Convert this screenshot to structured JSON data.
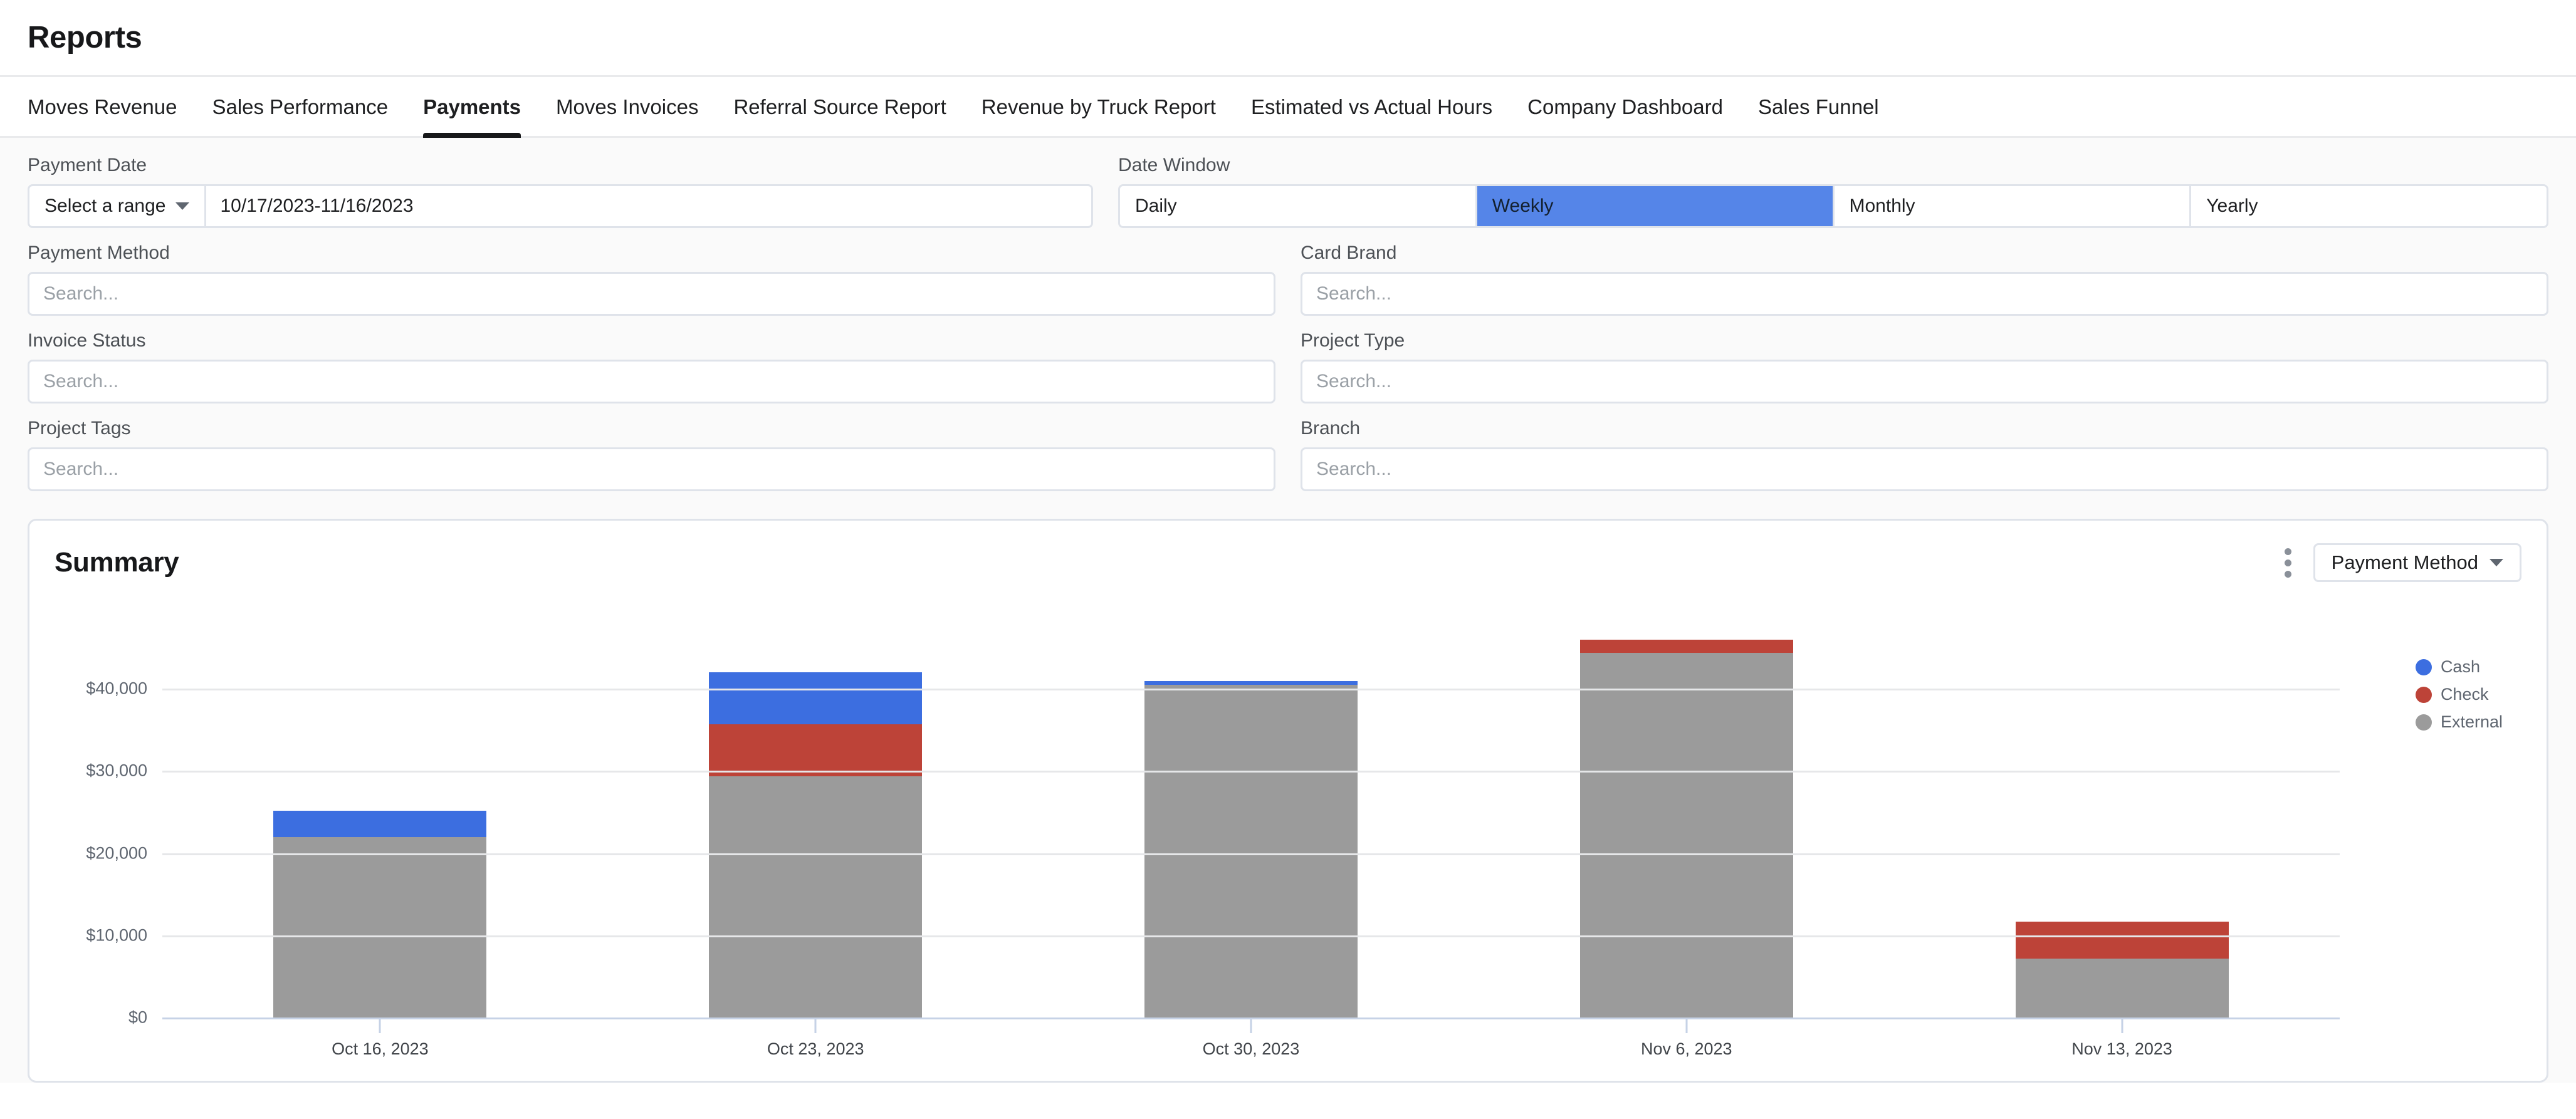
{
  "header": {
    "title": "Reports"
  },
  "tabs": [
    {
      "label": "Moves Revenue",
      "active": false
    },
    {
      "label": "Sales Performance",
      "active": false
    },
    {
      "label": "Payments",
      "active": true
    },
    {
      "label": "Moves Invoices",
      "active": false
    },
    {
      "label": "Referral Source Report",
      "active": false
    },
    {
      "label": "Revenue by Truck Report",
      "active": false
    },
    {
      "label": "Estimated vs Actual Hours",
      "active": false
    },
    {
      "label": "Company Dashboard",
      "active": false
    },
    {
      "label": "Sales Funnel",
      "active": false
    }
  ],
  "filters": {
    "payment_date": {
      "label": "Payment Date",
      "select_label": "Select a range",
      "value": "10/17/2023-11/16/2023"
    },
    "date_window": {
      "label": "Date Window",
      "options": [
        "Daily",
        "Weekly",
        "Monthly",
        "Yearly"
      ],
      "selected": "Weekly",
      "selected_color": "#5585e8"
    },
    "payment_method": {
      "label": "Payment Method",
      "placeholder": "Search...",
      "value": ""
    },
    "card_brand": {
      "label": "Card Brand",
      "placeholder": "Search...",
      "value": ""
    },
    "invoice_status": {
      "label": "Invoice Status",
      "placeholder": "Search...",
      "value": ""
    },
    "project_type": {
      "label": "Project Type",
      "placeholder": "Search...",
      "value": ""
    },
    "project_tags": {
      "label": "Project Tags",
      "placeholder": "Search...",
      "value": ""
    },
    "branch": {
      "label": "Branch",
      "placeholder": "Search...",
      "value": ""
    }
  },
  "summary_card": {
    "title": "Summary",
    "menu_icon": "kebab-menu-icon",
    "group_by": {
      "label": "Payment Method",
      "caret_icon": "chevron-down-icon"
    }
  },
  "chart_data": {
    "type": "bar",
    "stacked": true,
    "title": "Summary",
    "xlabel": "",
    "ylabel": "",
    "ylim": [
      0,
      46500
    ],
    "grid": true,
    "legend_position": "right",
    "ytick_values": [
      0,
      10000,
      20000,
      30000,
      40000
    ],
    "ytick_labels": [
      "$0",
      "$10,000",
      "$20,000",
      "$30,000",
      "$40,000"
    ],
    "categories": [
      "Oct 16, 2023",
      "Oct 23, 2023",
      "Oct 30, 2023",
      "Nov 6, 2023",
      "Nov 13, 2023"
    ],
    "series": [
      {
        "name": "External",
        "color": "#9b9b9b",
        "values": [
          22200,
          29600,
          40700,
          44600,
          7400
        ]
      },
      {
        "name": "Check",
        "color": "#bd4338",
        "values": [
          0,
          6300,
          0,
          1600,
          4500
        ]
      },
      {
        "name": "Cash",
        "color": "#3c6ee0",
        "values": [
          3200,
          6300,
          500,
          0,
          0
        ]
      }
    ],
    "totals": [
      25400,
      42200,
      41200,
      46200,
      11900
    ],
    "legend": [
      {
        "label": "Cash",
        "color": "#3c6ee0"
      },
      {
        "label": "Check",
        "color": "#bd4338"
      },
      {
        "label": "External",
        "color": "#9b9b9b"
      }
    ]
  }
}
